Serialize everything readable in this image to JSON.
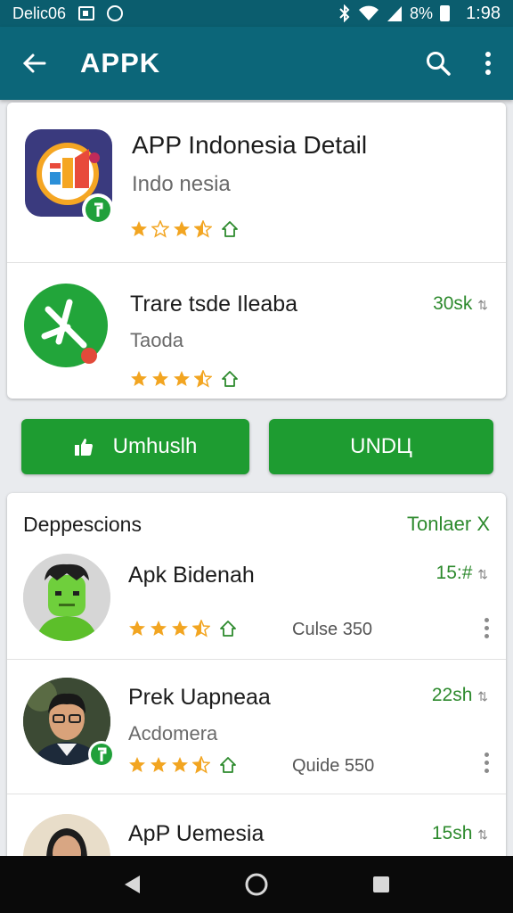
{
  "status_bar": {
    "carrier": "Delic06",
    "battery": "8%",
    "time": "1:98"
  },
  "app_bar": {
    "title": "APPK"
  },
  "featured": [
    {
      "title": "APP Indonesia Detail",
      "subtitle": "Indo nesia",
      "rating": 2.5
    },
    {
      "title": "Trare tsde Ileaba",
      "subtitle": "Taodа",
      "size": "30sk",
      "rating": 3.5
    }
  ],
  "actions": {
    "primary": "Umhuslh",
    "secondary": "UNDЦ"
  },
  "section": {
    "title": "Deppescions",
    "link": "Tonlaer X",
    "items": [
      {
        "title": "Apk Bidenah",
        "size": "15:#",
        "meta": "Culse 350",
        "rating": 3.5
      },
      {
        "title": "Prek Uapneaa",
        "subtitle": "Acdomera",
        "size": "22sh",
        "meta": "Quide 550",
        "rating": 3.5
      },
      {
        "title": "ApP Uemesia",
        "size": "15sh"
      }
    ]
  },
  "colors": {
    "status_bar": "#0b5d6e",
    "app_bar": "#0c6679",
    "accent_green": "#1e9c31",
    "star": "#f2a521"
  },
  "icons": {
    "back": "arrow-left-icon",
    "search": "search-icon",
    "more": "more-vert-icon",
    "star": "star-icon",
    "home": "home-outline-icon"
  }
}
